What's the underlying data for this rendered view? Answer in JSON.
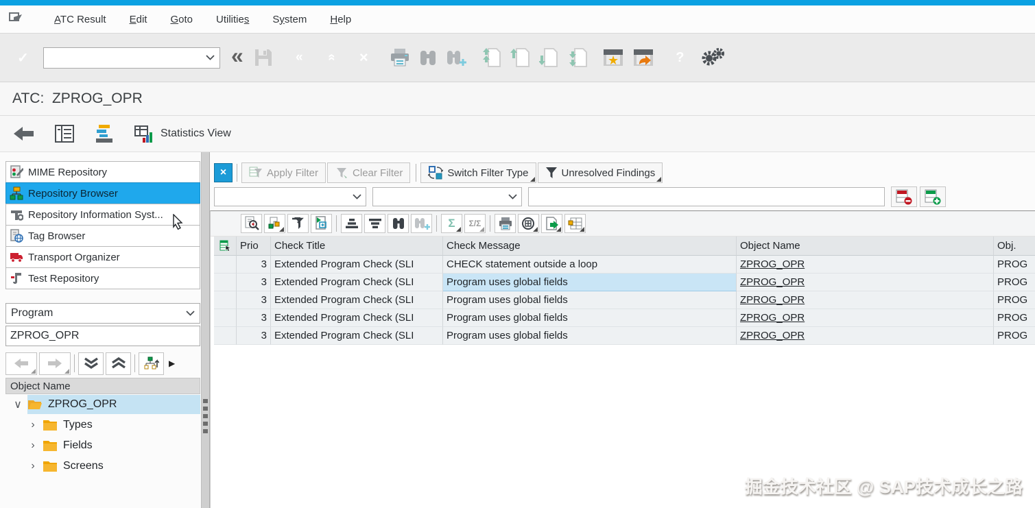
{
  "titlebar": {
    "title": "ATC:  ZPROG_OPR"
  },
  "menubar": {
    "items": [
      {
        "pre": "",
        "key": "A",
        "post": "TC Result"
      },
      {
        "pre": "",
        "key": "E",
        "post": "dit"
      },
      {
        "pre": "",
        "key": "G",
        "post": "oto"
      },
      {
        "pre": "Utilitie",
        "key": "s",
        "post": ""
      },
      {
        "pre": "S",
        "key": "y",
        "post": "stem"
      },
      {
        "pre": "",
        "key": "H",
        "post": "elp"
      }
    ]
  },
  "toolbar": {
    "command_field_value": ""
  },
  "appbar": {
    "statistics_view_label": "Statistics View"
  },
  "sidebar": {
    "nav_items": [
      "MIME Repository",
      "Repository Browser",
      "Repository Information Syst...",
      "Tag Browser",
      "Transport Organizer",
      "Test Repository"
    ],
    "selected_item": "Repository Browser",
    "object_type_selected": "Program",
    "object_name_value": "ZPROG_OPR",
    "tree": {
      "header": "Object Name",
      "root_label": "ZPROG_OPR",
      "children": [
        "Types",
        "Fields",
        "Screens"
      ]
    }
  },
  "filterbar": {
    "apply_filter_label": "Apply Filter",
    "clear_filter_label": "Clear Filter",
    "switch_filter_type_label": "Switch Filter Type",
    "findings_dropdown_label": "Unresolved Findings",
    "filter_value_1": "",
    "filter_value_2": "",
    "filter_value_3": ""
  },
  "results_table": {
    "columns": {
      "prio": "Prio",
      "check_title": "Check Title",
      "check_message": "Check Message",
      "object_name": "Object Name",
      "obj_type": "Obj."
    },
    "rows": [
      {
        "prio": "3",
        "check_title": "Extended Program Check (SLI",
        "check_message": "CHECK statement outside a loop",
        "object_name": "ZPROG_OPR",
        "obj_type": "PROG"
      },
      {
        "prio": "3",
        "check_title": "Extended Program Check (SLI",
        "check_message": "Program uses global fields",
        "object_name": "ZPROG_OPR",
        "obj_type": "PROG"
      },
      {
        "prio": "3",
        "check_title": "Extended Program Check (SLI",
        "check_message": "Program uses global fields",
        "object_name": "ZPROG_OPR",
        "obj_type": "PROG"
      },
      {
        "prio": "3",
        "check_title": "Extended Program Check (SLI",
        "check_message": "Program uses global fields",
        "object_name": "ZPROG_OPR",
        "obj_type": "PROG"
      },
      {
        "prio": "3",
        "check_title": "Extended Program Check (SLI",
        "check_message": "Program uses global fields",
        "object_name": "ZPROG_OPR",
        "obj_type": "PROG"
      }
    ],
    "selected_cell": {
      "row_index": 1,
      "column": "check_message"
    }
  },
  "watermark": {
    "text": "掘金技术社区 @ SAP技术成长之路"
  },
  "icons": {
    "enter_glyph": "✓",
    "back_glyph": "«",
    "exit_glyph": "«",
    "cancel_glyph": "×",
    "collapse_glyph": "«",
    "help_glyph": "?",
    "close_filter_glyph": "×",
    "sum_glyph": "Σ",
    "subtotal_glyph": "Σ/Σ",
    "tree_expanded_glyph": "∨",
    "tree_collapsed_glyph": "›",
    "overflow_glyph": "▶"
  },
  "colors": {
    "top_accent": "#0ba1e2",
    "nav_selection": "#1fa8ec",
    "cell_highlight": "#c9e5f6",
    "amber": "#f0ab00",
    "green": "#0c9b4a",
    "red": "#cf2333"
  }
}
